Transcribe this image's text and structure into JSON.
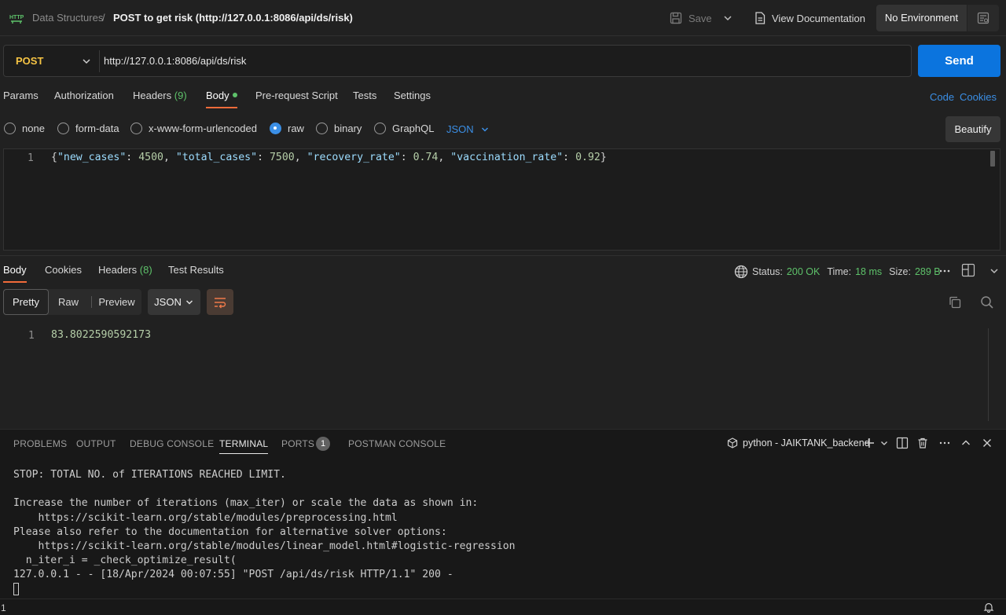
{
  "header": {
    "breadcrumb_parent": "Data Structures",
    "breadcrumb_separator": "/",
    "request_title": "POST to get risk (http://127.0.0.1:8086/api/ds/risk)",
    "save_label": "Save",
    "view_docs_label": "View Documentation",
    "environment_label": "No Environment"
  },
  "request": {
    "method": "POST",
    "url": "http://127.0.0.1:8086/api/ds/risk",
    "send_label": "Send",
    "tabs": [
      {
        "label": "Params"
      },
      {
        "label": "Authorization"
      },
      {
        "label": "Headers",
        "count": "(9)"
      },
      {
        "label": "Body"
      },
      {
        "label": "Pre-request Script"
      },
      {
        "label": "Tests"
      },
      {
        "label": "Settings"
      }
    ],
    "code_link": "Code",
    "cookies_link": "Cookies",
    "body_types": [
      "none",
      "form-data",
      "x-www-form-urlencoded",
      "raw",
      "binary",
      "GraphQL"
    ],
    "selected_body_type": "raw",
    "raw_format": "JSON",
    "beautify_label": "Beautify",
    "body_line_number": "1",
    "body": {
      "open": "{",
      "k1": "\"new_cases\"",
      "v1": "4500",
      "k2": "\"total_cases\"",
      "v2": "7500",
      "k3": "\"recovery_rate\"",
      "v3": "0.74",
      "k4": "\"vaccination_rate\"",
      "v4": "0.92",
      "close": "}"
    }
  },
  "response": {
    "tabs": [
      {
        "label": "Body"
      },
      {
        "label": "Cookies"
      },
      {
        "label": "Headers",
        "count": "(8)"
      },
      {
        "label": "Test Results"
      }
    ],
    "status_label": "Status:",
    "status_value": "200 OK",
    "time_label": "Time:",
    "time_value": "18 ms",
    "size_label": "Size:",
    "size_value": "289 B",
    "view_modes": [
      "Pretty",
      "Raw",
      "Preview"
    ],
    "format": "JSON",
    "line_number": "1",
    "value": "83.8022590592173"
  },
  "panel": {
    "tabs": [
      "PROBLEMS",
      "OUTPUT",
      "DEBUG CONSOLE",
      "TERMINAL",
      "PORTS",
      "POSTMAN CONSOLE"
    ],
    "ports_badge": "1",
    "terminal_name": "python - JAIKTANK_backend",
    "terminal_lines": [
      "STOP: TOTAL NO. of ITERATIONS REACHED LIMIT.",
      "",
      "Increase the number of iterations (max_iter) or scale the data as shown in:",
      "    https://scikit-learn.org/stable/modules/preprocessing.html",
      "Please also refer to the documentation for alternative solver options:",
      "    https://scikit-learn.org/stable/modules/linear_model.html#logistic-regression",
      "  n_iter_i = _check_optimize_result(",
      "127.0.0.1 - - [18/Apr/2024 00:07:55] \"POST /api/ds/risk HTTP/1.1\" 200 -"
    ]
  },
  "statusbar": {
    "left_text": "1"
  },
  "colors": {
    "accent_blue": "#0b74de",
    "method_post": "#f6c444",
    "status_green": "#5ec26a",
    "active_tab_underline": "#f26b3a"
  }
}
